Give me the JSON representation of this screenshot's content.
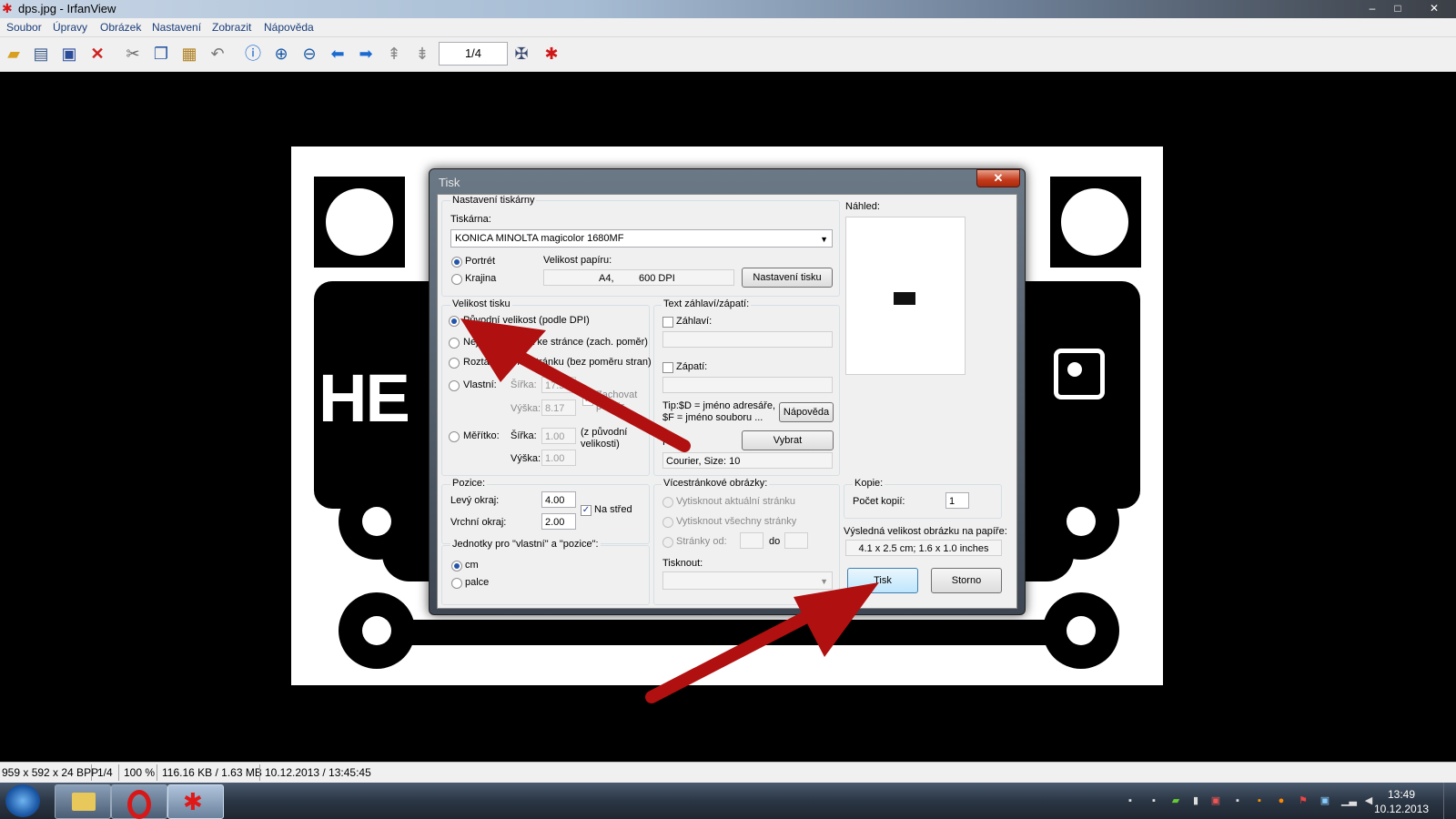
{
  "window": {
    "title": "dps.jpg - IrfanView",
    "minimize": "–",
    "maximize": "□",
    "close": "✕"
  },
  "menu": [
    "Soubor",
    "Úpravy",
    "Obrázek",
    "Nastavení",
    "Zobrazit",
    "Nápověda"
  ],
  "toolbar": {
    "page_counter": "1/4"
  },
  "image": {
    "pcb_text": "HE"
  },
  "statusbar": {
    "dims": "959 x 592 x 24 BPP",
    "page": "1/4",
    "zoom": "100 %",
    "size": "116.16 KB / 1.63 MB",
    "datetime": "10.12.2013 / 13:45:45"
  },
  "taskbar": {
    "time": "13:49",
    "date": "10.12.2013"
  },
  "dialog": {
    "title": "Tisk",
    "close": "✕",
    "printer_group": "Nastavení tiskárny",
    "printer_label": "Tiskárna:",
    "printer_value": "KONICA MINOLTA magicolor 1680MF",
    "portrait": "Portrét",
    "landscape": "Krajina",
    "paper_label": "Velikost papíru:",
    "paper_value": "A4,         600 DPI",
    "print_setup_btn": "Nastavení tisku",
    "preview_label": "Náhled:",
    "size_group": "Velikost tisku",
    "size_original": "Původní velikost (podle DPI)",
    "size_fit": "Nejl. přizpůsobit ke stránce (zach. poměr)",
    "size_stretch": "Roztáhnout na stránku (bez poměru stran)",
    "size_custom": "Vlastní:",
    "custom_width_label": "Šířka:",
    "custom_width": "17.55",
    "custom_height_label": "Výška:",
    "custom_height": "8.17",
    "keep_ratio": "Zachovat poměr",
    "size_scale": "Měřítko:",
    "scale_width_label": "Šířka:",
    "scale_width": "1.00",
    "scale_height_label": "Výška:",
    "scale_height": "1.00",
    "scale_note": "(z původní velikosti)",
    "header_group": "Text záhlaví/zápatí:",
    "header_chk": "Záhlaví:",
    "footer_chk": "Zápatí:",
    "tip": "Tip:$D = jméno adresáře, $F = jméno souboru ...",
    "help_btn": "Nápověda",
    "font_label": "Font:",
    "choose_btn": "Vybrat",
    "font_value": "Courier, Size: 10",
    "position_group": "Pozice:",
    "left_margin_label": "Levý okraj:",
    "left_margin": "4.00",
    "top_margin_label": "Vrchní okraj:",
    "top_margin": "2.00",
    "center_chk": "Na střed",
    "units_group": "Jednotky pro \"vlastní\" a \"pozice\":",
    "unit_cm": "cm",
    "unit_inch": "palce",
    "multipage_group": "Vícestránkové obrázky:",
    "mp_current": "Vytisknout aktuální stránku",
    "mp_all": "Vytisknout všechny stránky",
    "mp_range": "Stránky od:",
    "mp_to": "do",
    "print_what_label": "Tisknout:",
    "copies_group": "Kopie:",
    "copies_label": "Počet kopií:",
    "copies_value": "1",
    "result_label": "Výsledná velikost obrázku na papíře:",
    "result_value": "4.1 x 2.5 cm; 1.6 x 1.0 inches",
    "print_btn": "Tisk",
    "cancel_btn": "Storno"
  },
  "colors": {
    "arrow": "#b01010",
    "titlebar": "#a7bdd4",
    "dialog_frame": "#4e5a66"
  }
}
